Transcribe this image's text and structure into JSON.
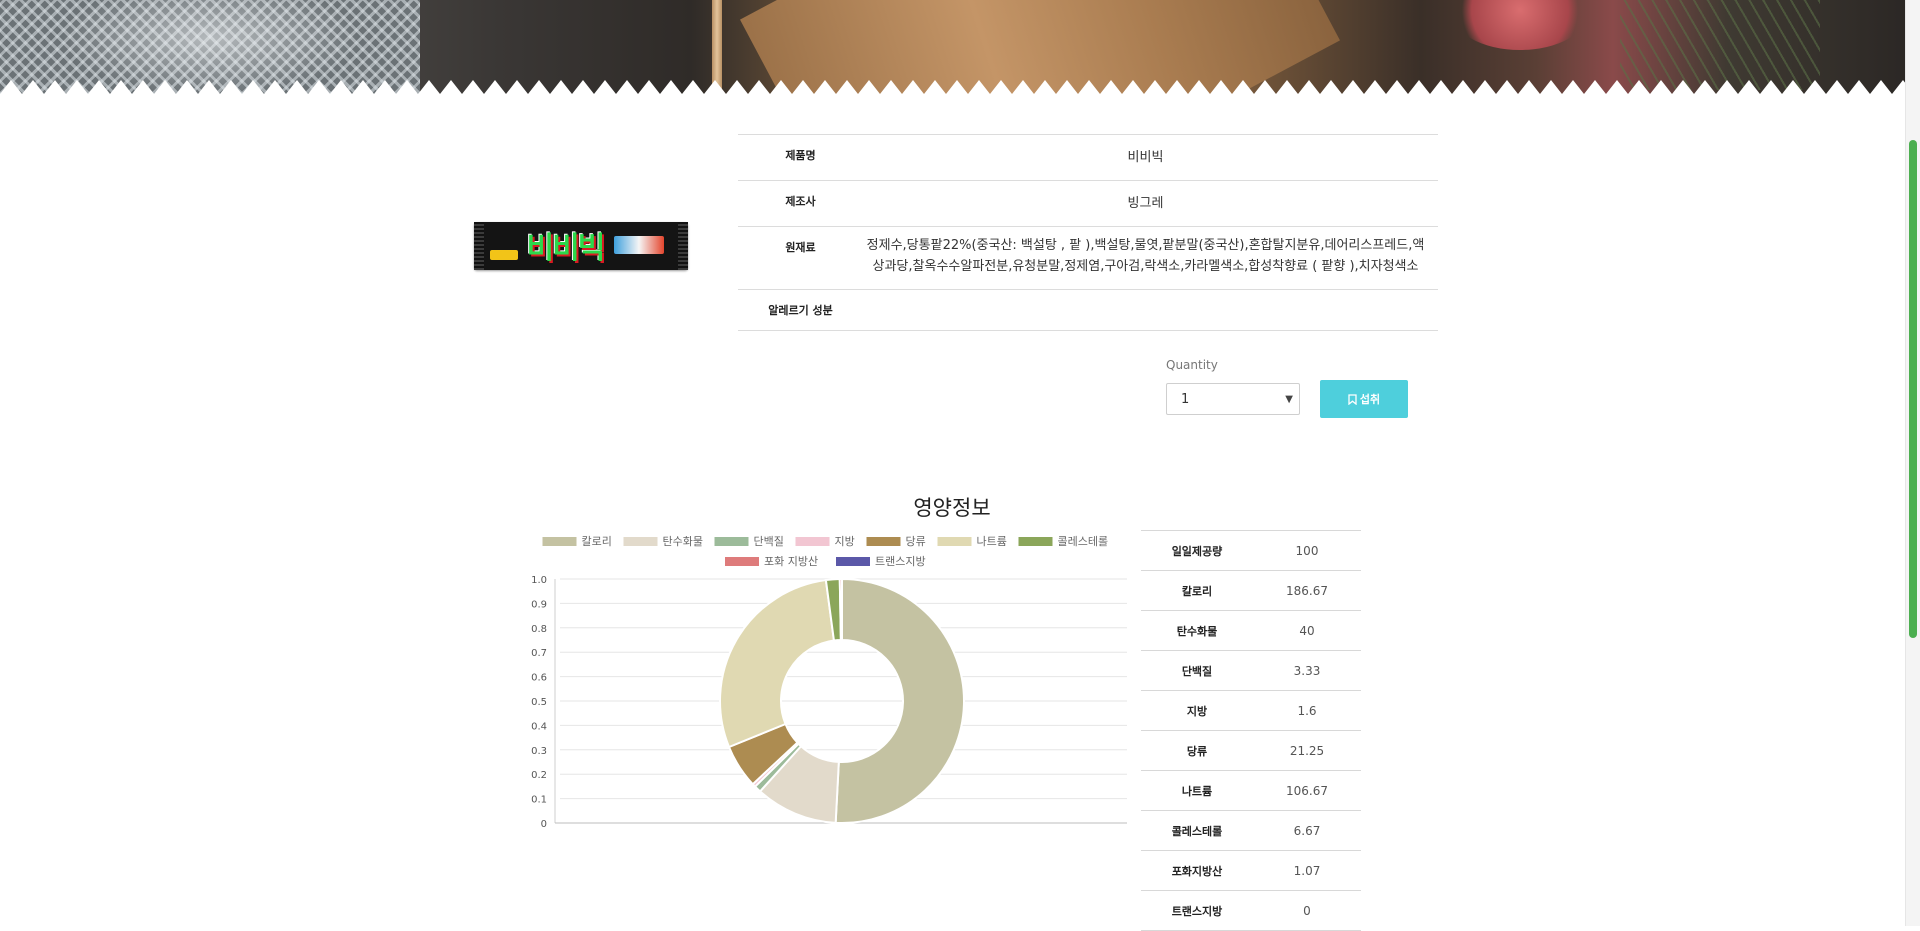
{
  "hero": {
    "image": "kitchen-banner"
  },
  "product": {
    "image_text": "비비빅",
    "rows": [
      {
        "label": "제품명",
        "value": "비비빅"
      },
      {
        "label": "제조사",
        "value": "빙그레"
      },
      {
        "label": "원재료",
        "value": "정제수,당통팥22%(중국산: 백설탕 , 팥 ),백설탕,물엿,팥분말(중국산),혼합탈지분유,데어리스프레드,액상과당,찰옥수수알파전분,유청분말,정제염,구아검,락색소,카라멜색소,합성착향료 ( 팥향 ),치자청색소"
      },
      {
        "label": "알레르기 성분",
        "value": ""
      }
    ]
  },
  "order": {
    "quantity_label": "Quantity",
    "quantity_value": "1",
    "ingest_button": "섭취",
    "ingest_icon": "bookmark-icon"
  },
  "nutrition": {
    "title": "영양정보",
    "table": [
      {
        "label": "일일제공량",
        "value": "100"
      },
      {
        "label": "칼로리",
        "value": "186.67"
      },
      {
        "label": "탄수화물",
        "value": "40"
      },
      {
        "label": "단백질",
        "value": "3.33"
      },
      {
        "label": "지방",
        "value": "1.6"
      },
      {
        "label": "당류",
        "value": "21.25"
      },
      {
        "label": "나트륨",
        "value": "106.67"
      },
      {
        "label": "콜레스테롤",
        "value": "6.67"
      },
      {
        "label": "포화지방산",
        "value": "1.07"
      },
      {
        "label": "트랜스지방",
        "value": "0"
      }
    ]
  },
  "chart_data": {
    "type": "pie",
    "style": "doughnut",
    "legend_position": "top",
    "categories": [
      "칼로리",
      "탄수화물",
      "단백질",
      "지방",
      "당류",
      "나트륨",
      "콜레스테롤",
      "포화 지방산",
      "트랜스지방"
    ],
    "values": [
      186.67,
      40,
      3.33,
      1.6,
      21.25,
      106.67,
      6.67,
      1.07,
      0
    ],
    "colors": [
      "#c4c2a2",
      "#e2dacb",
      "#9cbb9a",
      "#f2c6d2",
      "#ad8c51",
      "#e0d9b2",
      "#8ba65a",
      "#de7b7b",
      "#5b58a8"
    ],
    "y_ticks": [
      "1.0",
      "0.9",
      "0.8",
      "0.7",
      "0.6",
      "0.5",
      "0.4",
      "0.3",
      "0.2",
      "0.1",
      "0"
    ],
    "ylim": [
      0,
      1
    ],
    "grid": true
  }
}
